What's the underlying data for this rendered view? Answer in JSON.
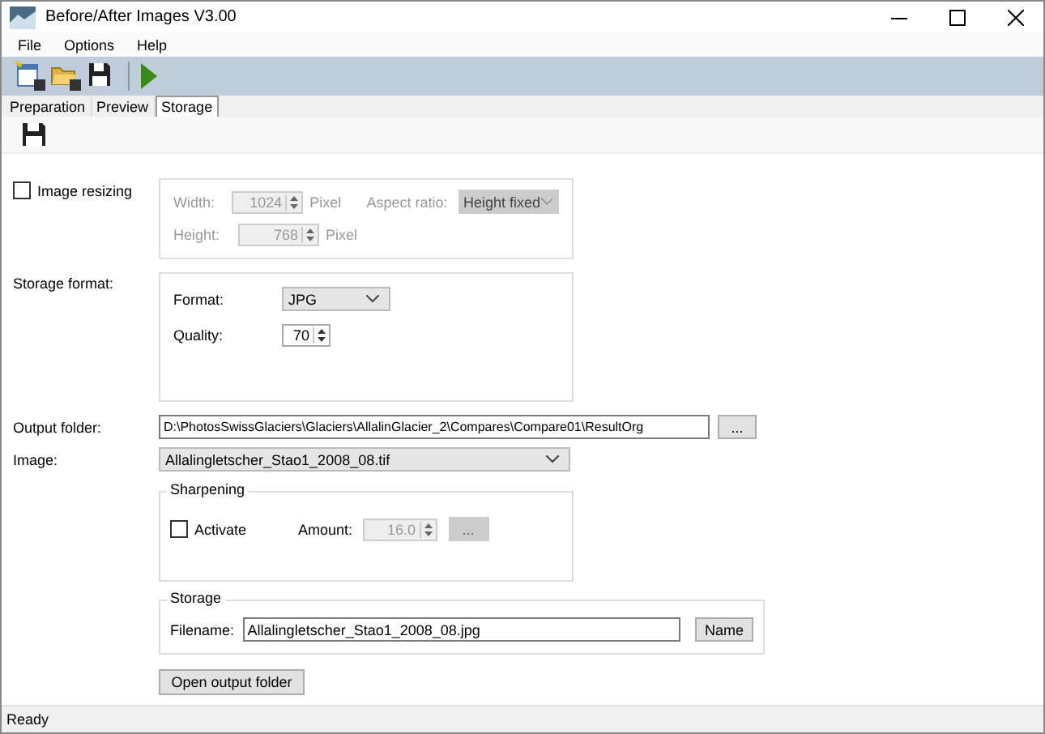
{
  "window": {
    "title": "Before/After Images V3.00"
  },
  "menu": [
    "File",
    "Options",
    "Help"
  ],
  "tabs": [
    {
      "label": "Preparation",
      "selected": false
    },
    {
      "label": "Preview",
      "selected": false
    },
    {
      "label": "Storage",
      "selected": true
    }
  ],
  "image_resizing": {
    "label": "Image resizing",
    "checked": false,
    "width_label": "Width:",
    "width_value": "1024",
    "width_unit": "Pixel",
    "height_label": "Height:",
    "height_value": "768",
    "height_unit": "Pixel",
    "aspect_label": "Aspect ratio:",
    "aspect_value": "Height fixed"
  },
  "storage_format": {
    "label": "Storage format:",
    "format_label": "Format:",
    "format_value": "JPG",
    "quality_label": "Quality:",
    "quality_value": "70"
  },
  "output_folder": {
    "label": "Output folder:",
    "value": "D:\\PhotosSwissGlaciers\\Glaciers\\AllalinGlacier_2\\Compares\\Compare01\\ResultOrg",
    "browse": "..."
  },
  "image": {
    "label": "Image:",
    "value": "Allalingletscher_Stao1_2008_08.tif"
  },
  "sharpening": {
    "title": "Sharpening",
    "activate_label": "Activate",
    "checked": false,
    "amount_label": "Amount:",
    "amount_value": "16.0",
    "options_button": "..."
  },
  "storage": {
    "title": "Storage",
    "filename_label": "Filename:",
    "filename_value": "Allalingletscher_Stao1_2008_08.jpg",
    "name_button": "Name"
  },
  "open_button": "Open output folder",
  "status_bar": "Ready"
}
